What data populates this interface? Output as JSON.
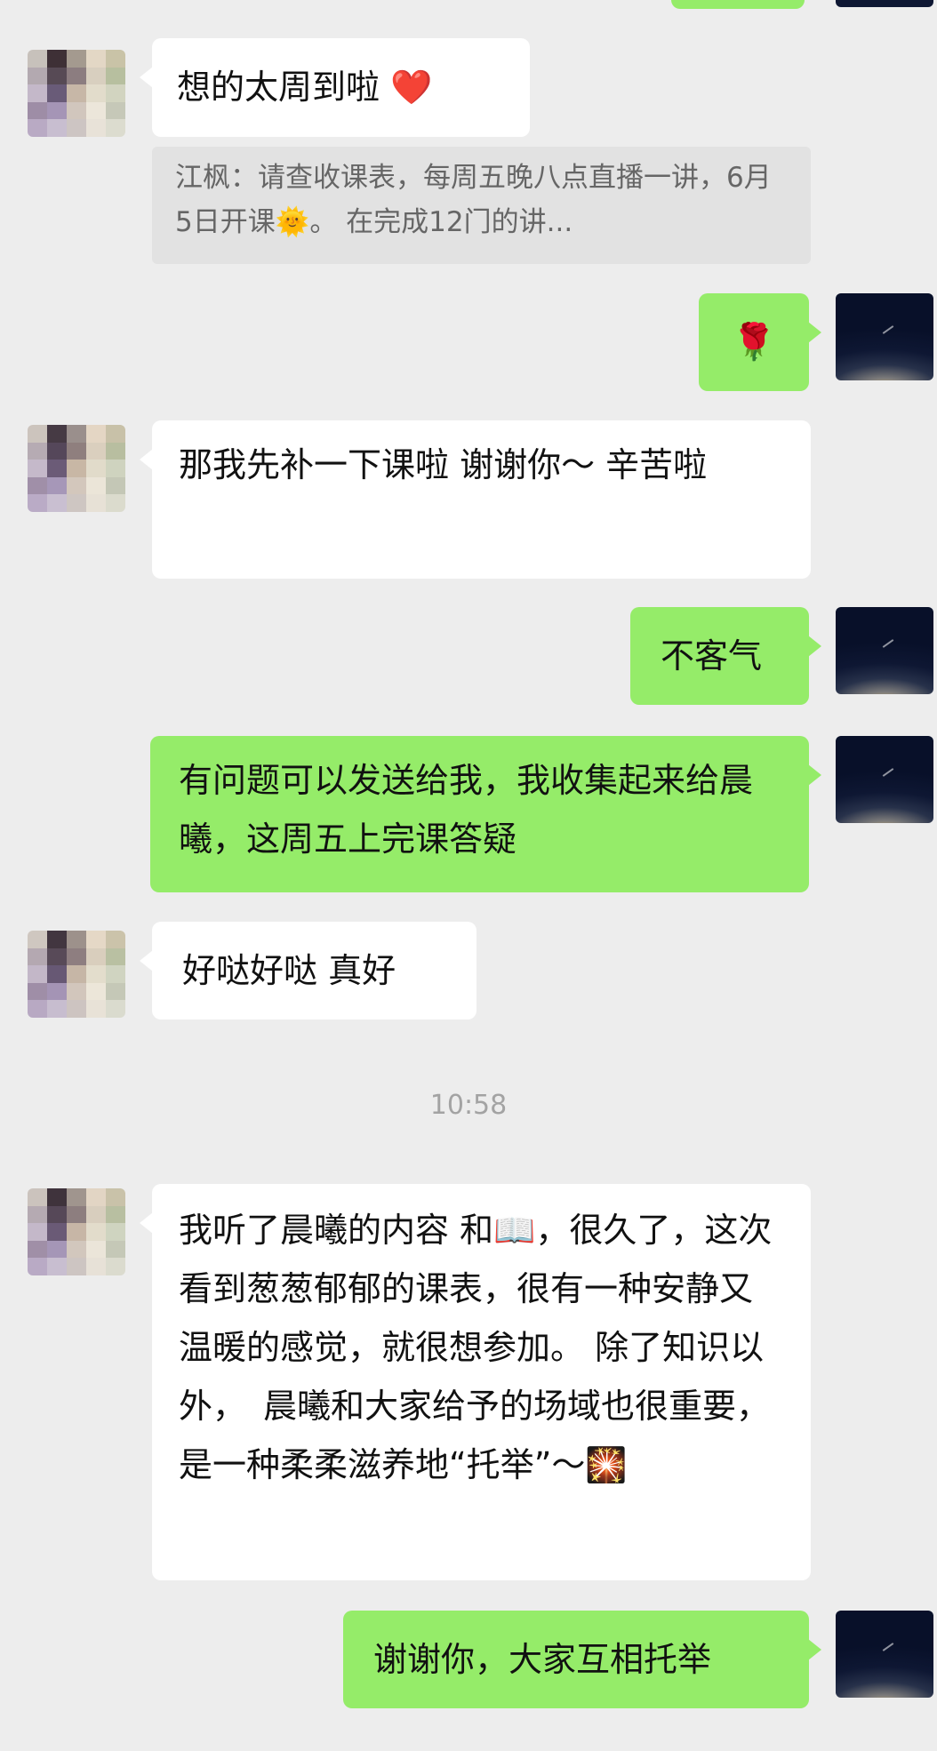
{
  "theme": {
    "background": "#ededed",
    "incoming_bubble": "#ffffff",
    "outgoing_bubble": "#95ec69",
    "quote_background": "#e2e2e2",
    "quote_text": "#666666",
    "timestamp_text": "#a3a3a3"
  },
  "messages": [
    {
      "id": "m1",
      "direction": "incoming",
      "avatar": "mosaic-avatar",
      "text": "想的太周到啦",
      "emoji": "❤️"
    },
    {
      "id": "m1q",
      "type": "quote",
      "text": "江枫：请查收课表，每周五晚八点直播一讲，6月5日开课🌞。 在完成12门的讲..."
    },
    {
      "id": "m2",
      "direction": "outgoing",
      "avatar": "night-sky-avatar",
      "text": "🌹"
    },
    {
      "id": "m3",
      "direction": "incoming",
      "avatar": "mosaic-avatar",
      "text": "那我先补一下课啦 谢谢你～ 辛苦啦"
    },
    {
      "id": "m4",
      "direction": "outgoing",
      "avatar": "night-sky-avatar",
      "text": "不客气"
    },
    {
      "id": "m5",
      "direction": "outgoing",
      "avatar": "night-sky-avatar",
      "text": "有问题可以发送给我，我收集起来给晨曦，这周五上完课答疑"
    },
    {
      "id": "m6",
      "direction": "incoming",
      "avatar": "mosaic-avatar",
      "text": "好哒好哒 真好"
    },
    {
      "id": "m7",
      "direction": "incoming",
      "avatar": "mosaic-avatar",
      "text": "我听了晨曦的内容 和📖，很久了，这次看到葱葱郁郁的课表，很有一种安静又温暖的感觉，就很想参加。 除了知识以外，　晨曦和大家给予的场域也很重要，是一种柔柔滋养地“托举”～🎇"
    },
    {
      "id": "m8",
      "direction": "outgoing",
      "avatar": "night-sky-avatar",
      "text": "谢谢你，大家互相托举"
    }
  ],
  "timestamp": "10:58"
}
